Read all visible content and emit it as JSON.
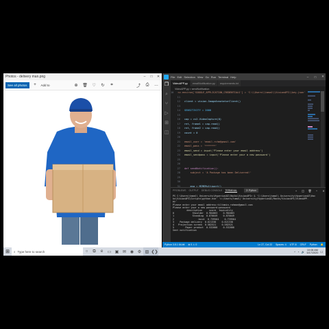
{
  "photos": {
    "title": "Photos - delivery man.png",
    "toolbar": {
      "see_all_photos": "See all photos",
      "add_to": "Add to"
    }
  },
  "vscode": {
    "tabs": [
      {
        "label": "VideoAPP.py",
        "active": true
      },
      {
        "label": "emailNotification.py",
        "active": false
      },
      {
        "label": "requirements.txt",
        "active": false
      }
    ],
    "breadcrumb": "VideoAPP.py > sendNotification",
    "code_lines": [
      {
        "n": "10",
        "text": "cv.environ['GOOGLE_APPLICATION_CREDENTIALS'] = 'C:\\\\Users\\\\tamal\\\\VisionAPI\\\\key.json'",
        "color": "#ce9178"
      },
      {
        "n": "11",
        "text": "",
        "color": "#d4d4d4"
      },
      {
        "n": "12",
        "text": "client = vision.ImageAnnotatorClient()",
        "color": "#9cdcfe"
      },
      {
        "n": "13",
        "text": "",
        "color": "#d4d4d4"
      },
      {
        "n": "14",
        "text": "SENSITIVITY = 2000",
        "color": "#4fc1ff"
      },
      {
        "n": "15",
        "text": "",
        "color": "#d4d4d4"
      },
      {
        "n": "16",
        "text": "cap = cv2.VideoCapture(0)",
        "color": "#9cdcfe"
      },
      {
        "n": "17",
        "text": "ret, frame1 = cap.read()",
        "color": "#9cdcfe"
      },
      {
        "n": "18",
        "text": "ret, frame2 = cap.read()",
        "color": "#9cdcfe"
      },
      {
        "n": "19",
        "text": "count = 0",
        "color": "#9cdcfe"
      },
      {
        "n": "20",
        "text": "",
        "color": "#d4d4d4"
      },
      {
        "n": "21",
        "text": "email_user = 'email.rchm@gmail.com'",
        "color": "#ce9178"
      },
      {
        "n": "22",
        "text": "email_pass = '*******'",
        "color": "#ce9178"
      },
      {
        "n": "23",
        "text": "email_send = input('Please enter your email address')",
        "color": "#dcdcaa"
      },
      {
        "n": "24",
        "text": "email_sendpass = input('Please enter your a new password')",
        "color": "#dcdcaa"
      },
      {
        "n": "25",
        "text": "",
        "color": "#d4d4d4"
      },
      {
        "n": "26",
        "text": "",
        "color": "#d4d4d4"
      },
      {
        "n": "27",
        "text": "def sendNotification():",
        "color": "#c586c0"
      },
      {
        "n": "28",
        "text": "    subject = 'A Package has been Delivered!'",
        "color": "#ce9178"
      },
      {
        "n": "29",
        "text": "",
        "color": "#d4d4d4"
      },
      {
        "n": "30",
        "text": "",
        "color": "#d4d4d4"
      },
      {
        "n": "31",
        "text": "    msg = MIMEMultipart()",
        "color": "#9cdcfe"
      },
      {
        "n": "32",
        "text": "    msg['From'] = email_user",
        "color": "#9cdcfe"
      },
      {
        "n": "33",
        "text": "    msg['To'] = email_send",
        "color": "#9cdcfe"
      }
    ],
    "panel": {
      "tabs": [
        "PROBLEMS",
        "OUTPUT",
        "DEBUG CONSOLE",
        "TERMINAL"
      ],
      "active_tab": "TERMINAL",
      "shell": "2: Python"
    },
    "terminal_lines": [
      "PS C:\\Users\\tamal\\ University\\HyperionAI\\Hacks\\VisionAPI> & 'C:\\Users\\tamal\\ University\\HyperionAI\\Hac",
      "ks\\VisionAPI\\Scripts\\python.exe' 'c:/Users/tamal/ University/HyperionAI/Hacks/VisionAPI/VideoAPP.",
      "py'",
      "Please enter your email address:tiltamin.rahman@gmail.com",
      "Please enter your a new password:password",
      "          description     score  topicality",
      "0             Shoulder  0.904063    0.904063",
      "1             Standing  0.870049    0.870049",
      "2                 Joint  0.739564    0.739564",
      "3    Package delivery  0.621338    0.621338",
      "4   Projection screen  0.582521    0.582521",
      "5        Paper product  0.532888    0.532888",
      "Sent notification"
    ],
    "statusbar": {
      "left": "Python 3.8.1 64-bit",
      "errors": "⊗ 0  ⚠ 0",
      "position": "Ln 27, Col 22",
      "spaces": "Spaces: 4",
      "encoding": "UTF-8",
      "eol": "CRLF",
      "language": "Python"
    }
  },
  "taskbar": {
    "search_placeholder": "Type here to search",
    "time": "10:08 AM",
    "date": "5/17/2020"
  },
  "chart_data": null
}
